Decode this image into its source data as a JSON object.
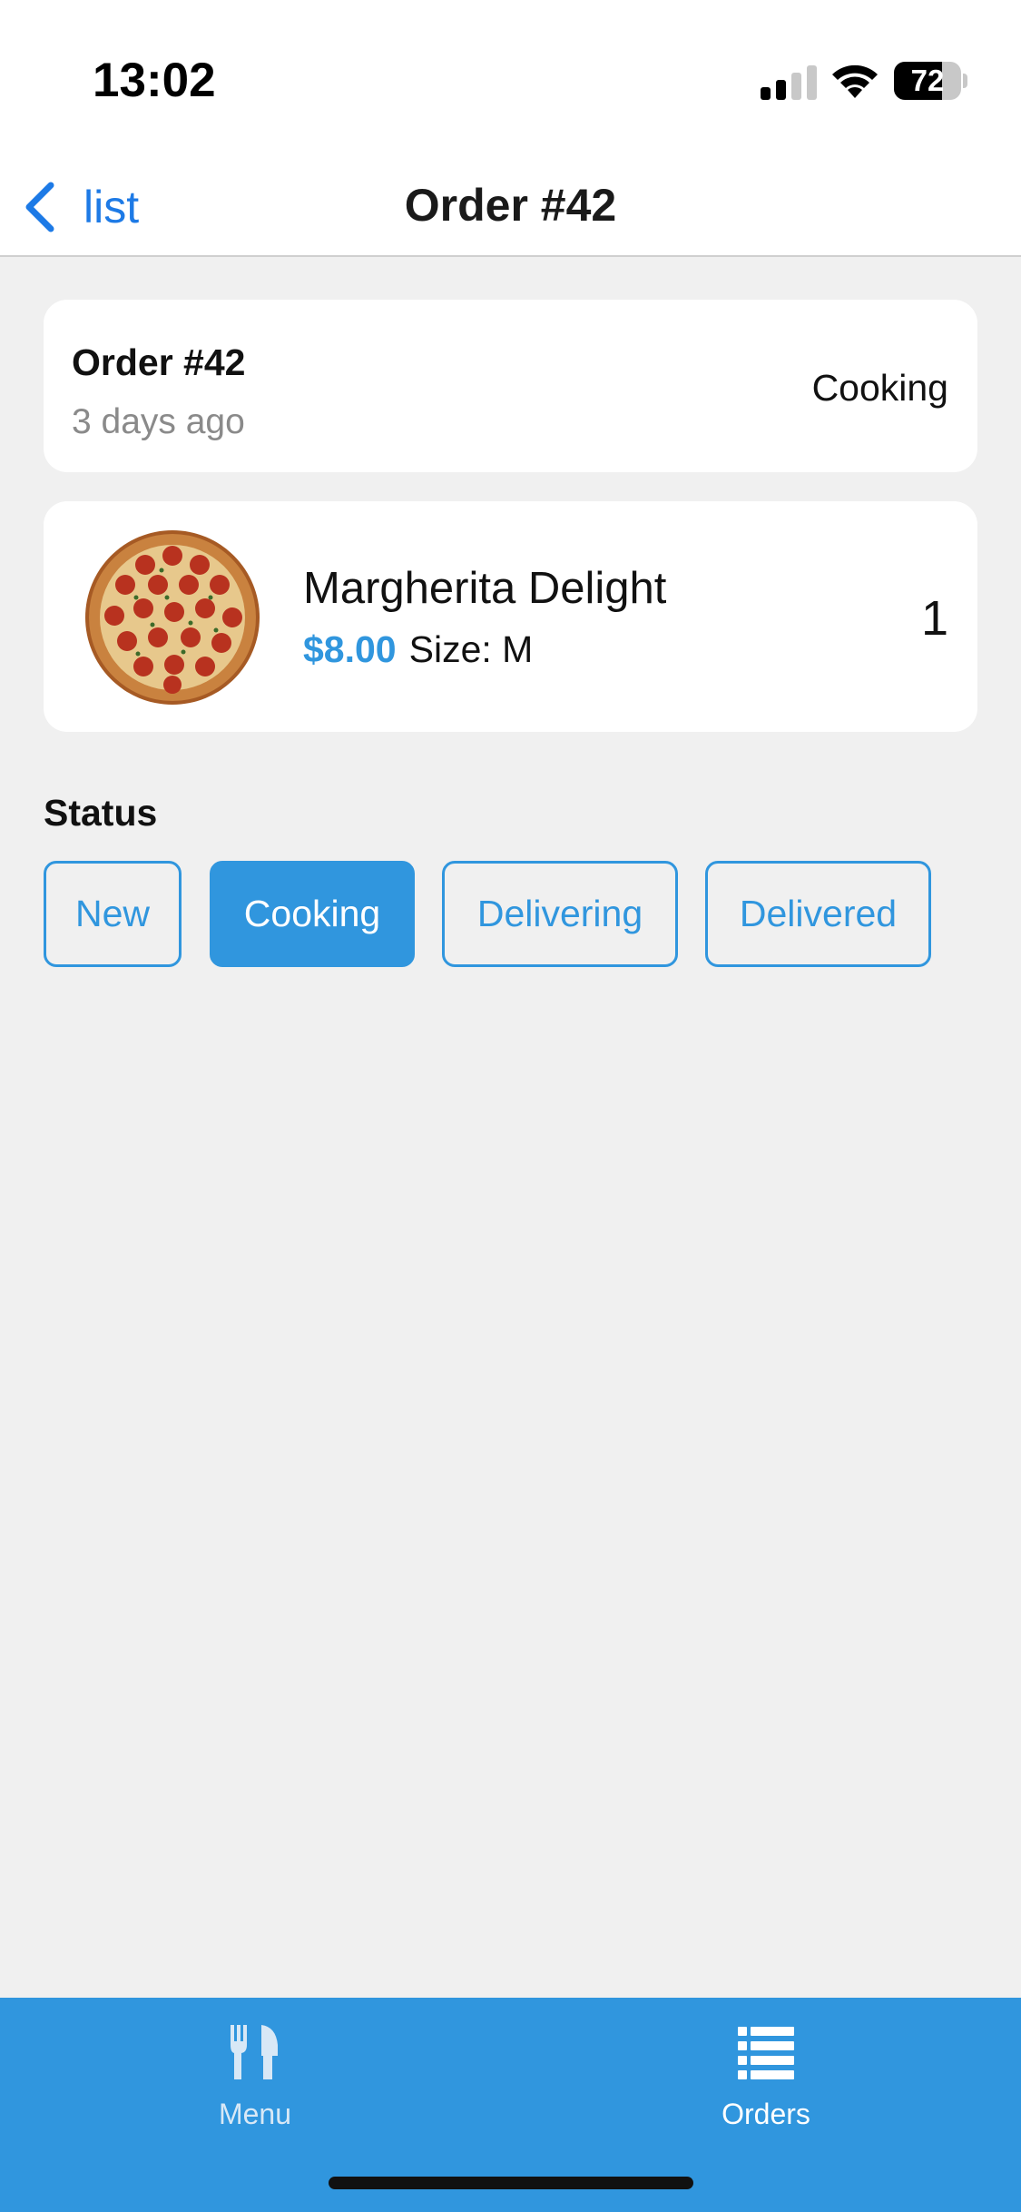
{
  "status_bar": {
    "time": "13:02",
    "battery_text": "72",
    "battery_level": 0.72,
    "icons": [
      "cellular-signal-icon",
      "wifi-icon",
      "battery-icon"
    ]
  },
  "nav": {
    "back_label": "list",
    "title": "Order #42",
    "back_icon": "chevron-left-icon"
  },
  "order_summary": {
    "order_id": "Order #42",
    "time_ago": "3 days ago",
    "status": "Cooking"
  },
  "items": [
    {
      "name": "Margherita Delight",
      "price": "$8.00",
      "size": "Size: M",
      "quantity": "1",
      "image": "pizza-image"
    }
  ],
  "status_section": {
    "heading": "Status",
    "options": [
      "New",
      "Cooking",
      "Delivering",
      "Delivered"
    ],
    "selected": "Cooking"
  },
  "tab_bar": {
    "tabs": [
      {
        "label": "Menu",
        "icon": "fork-knife-icon"
      },
      {
        "label": "Orders",
        "icon": "list-icon"
      }
    ],
    "active": "Orders"
  },
  "colors": {
    "accent": "#3096de",
    "ios_blue": "#1d7ae6",
    "background": "#f0f0f0",
    "card": "#ffffff"
  }
}
